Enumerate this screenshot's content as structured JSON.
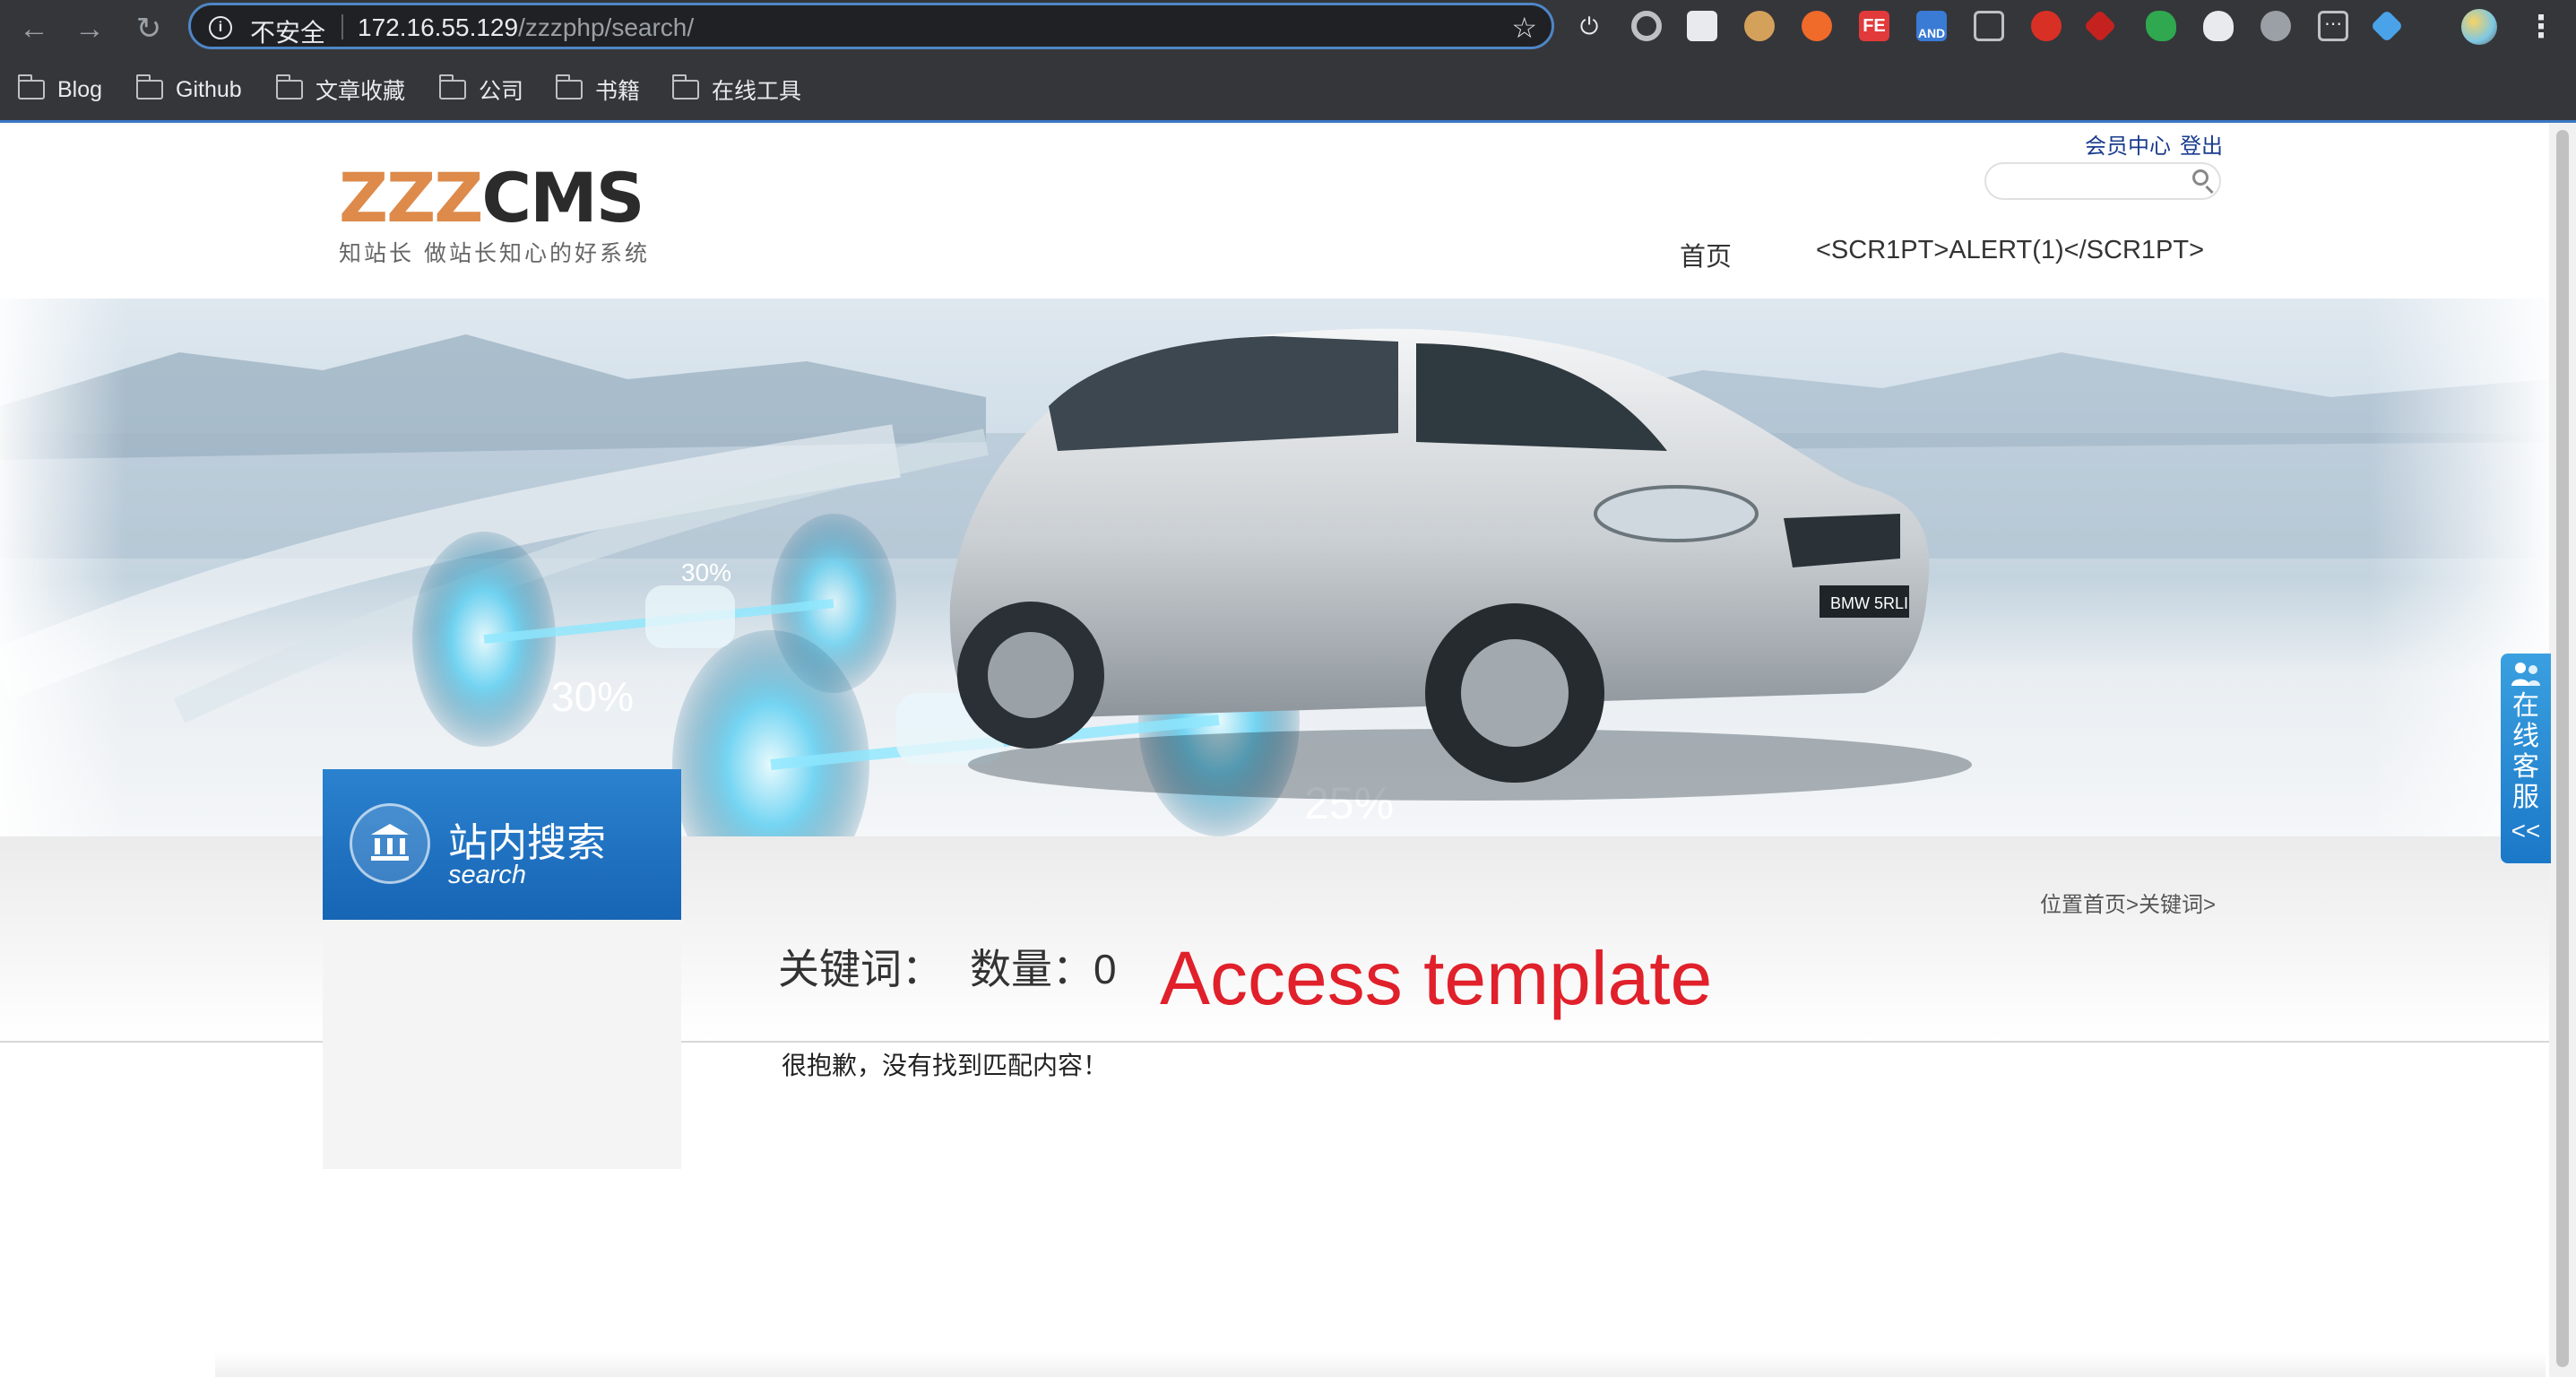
{
  "browser": {
    "insecure_label": "不安全",
    "url_host": "172.16.55.129",
    "url_path": "/zzzphp/search/",
    "bookmarks": [
      {
        "label": "Blog"
      },
      {
        "label": "Github"
      },
      {
        "label": "文章收藏"
      },
      {
        "label": "公司"
      },
      {
        "label": "书籍"
      },
      {
        "label": "在线工具"
      }
    ],
    "extension_badge": "AND"
  },
  "site": {
    "logo_zzz": "ZZZ",
    "logo_cms": "CMS",
    "logo_tagline": "知站长  做站长知心的好系统",
    "top_links": {
      "member": "会员中心",
      "logout": "登出"
    },
    "nav": [
      {
        "label": "首页"
      },
      {
        "label": "<SCR1PT>ALERT(1)</SCR1PT>"
      }
    ]
  },
  "banner": {
    "car_plate": "BMW 5RLI",
    "stat_left": "30%",
    "stat_small": "30%",
    "stat_right": "25%"
  },
  "sidebar": {
    "title_cn": "站内搜索",
    "title_en": "search"
  },
  "main": {
    "breadcrumb": "位置首页>关键词>",
    "keyword_label": "关键词：",
    "count_label": "数量：0",
    "no_result": "很抱歉，没有找到匹配内容！"
  },
  "annotation": {
    "text": "Access template",
    "color": "#e0202a"
  },
  "customer_service": {
    "chars": [
      "在",
      "线",
      "客",
      "服"
    ],
    "collapse": "<<"
  },
  "colors": {
    "brand_blue": "#1765b5",
    "logo_orange": "#dd8a4b",
    "link_blue": "#1a3c8f",
    "chrome_bg": "#35363a"
  }
}
